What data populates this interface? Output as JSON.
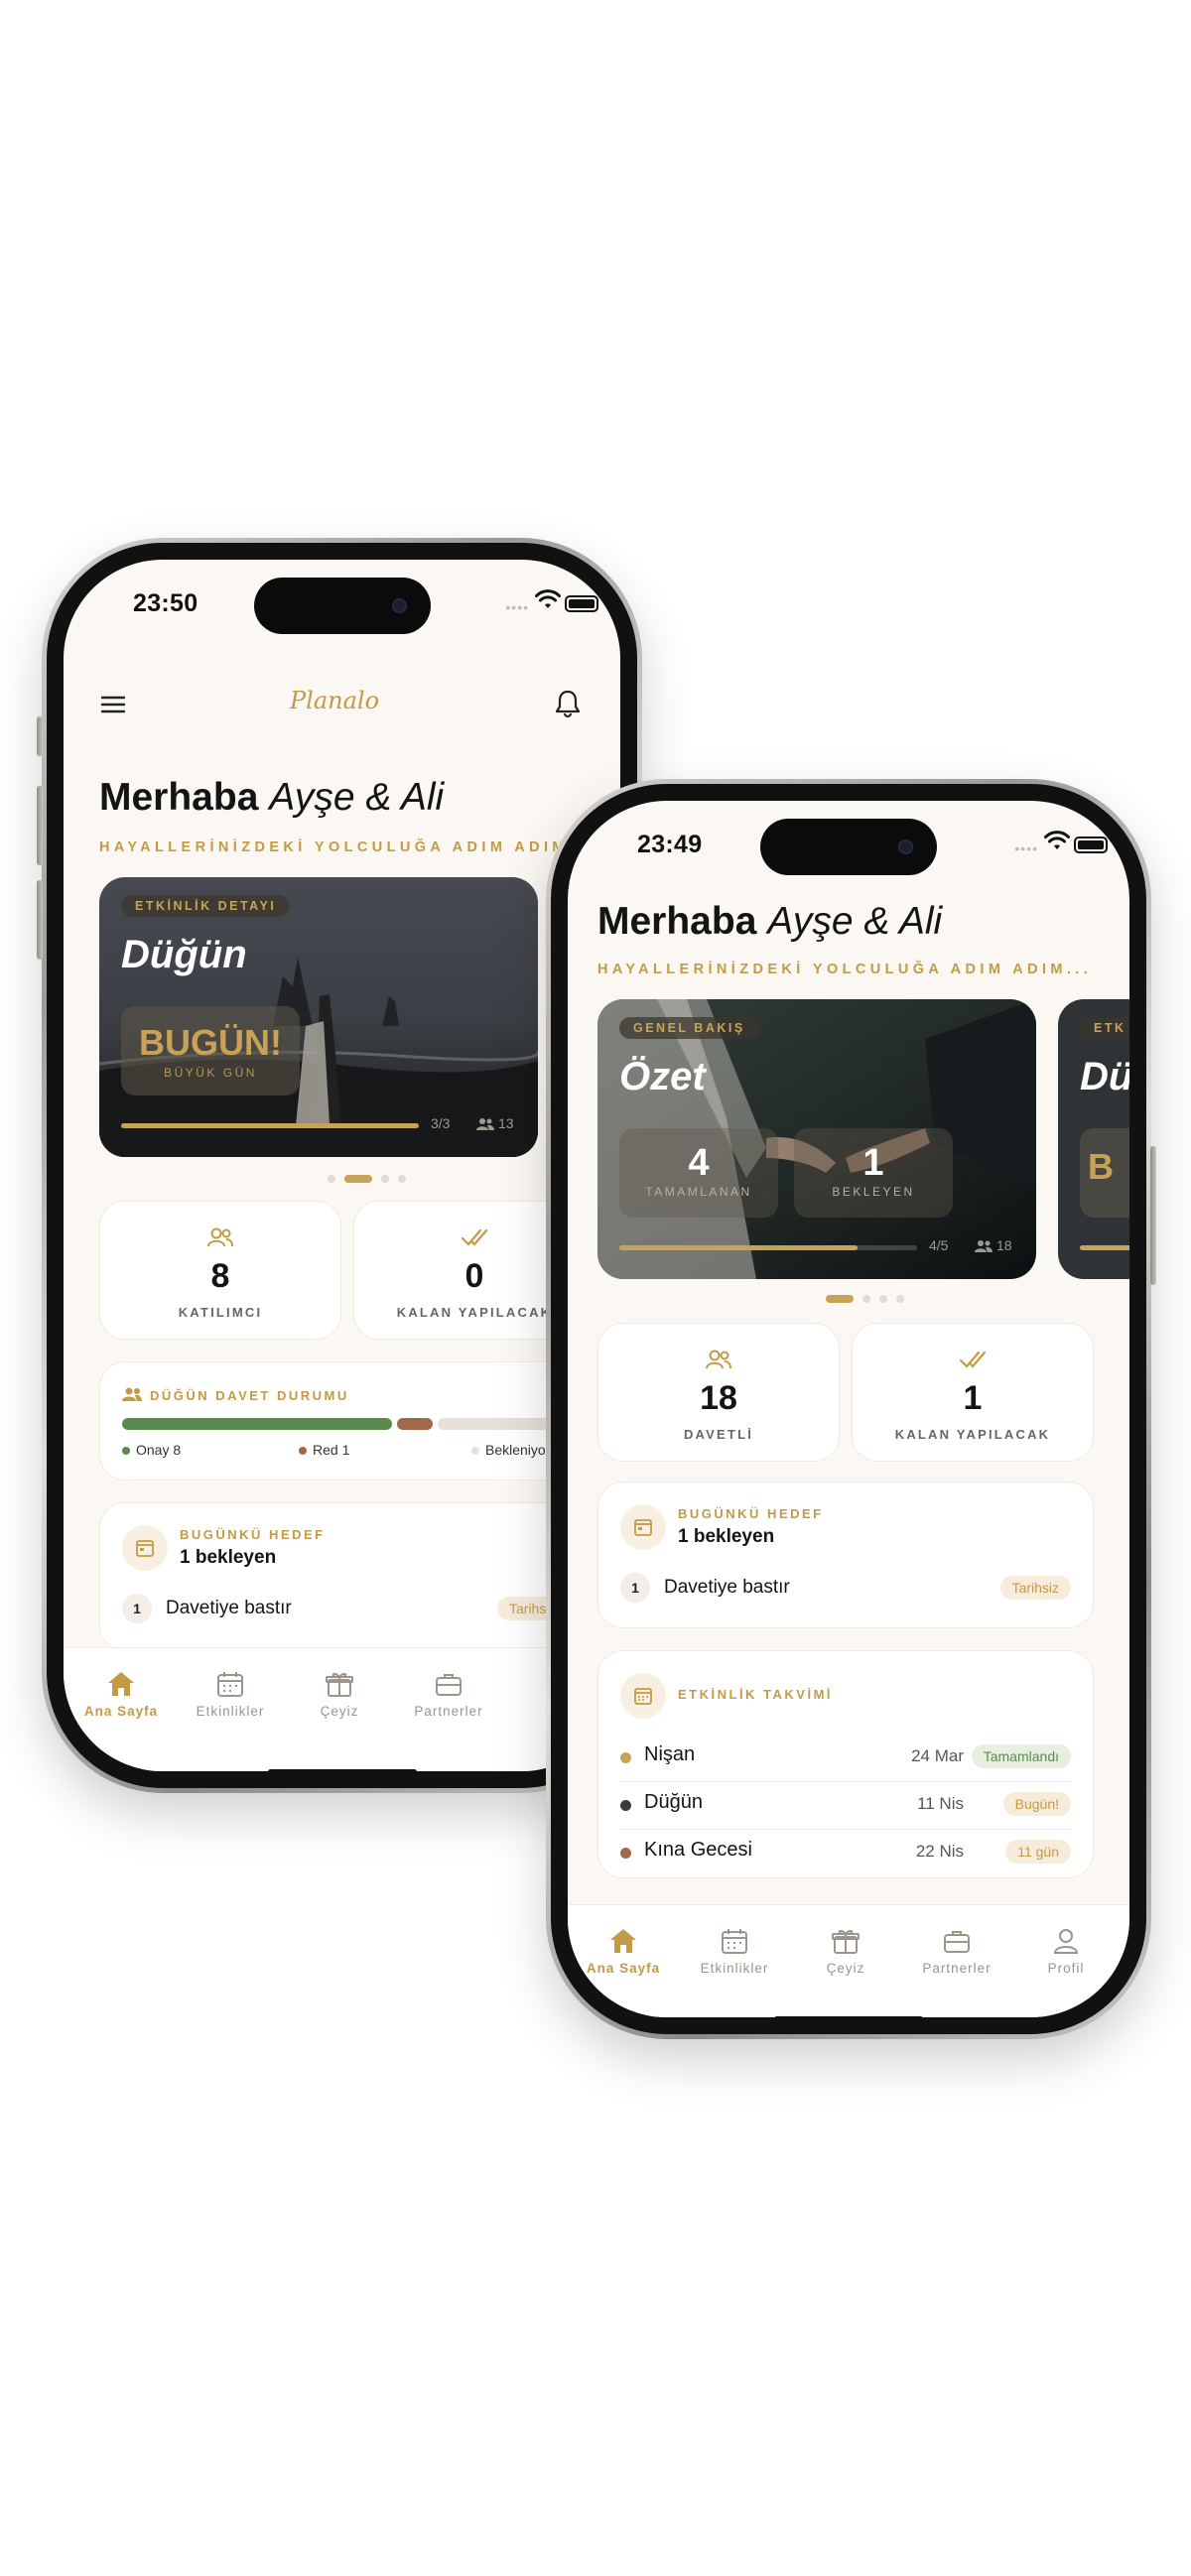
{
  "phone_left": {
    "time": "23:50",
    "logo": "Planalo",
    "greeting_bold": "Merhaba",
    "greeting_names": "Ayşe & Ali",
    "tagline": "HAYALLERİNİZDEKİ YOLCULUĞA ADIM ADIM...",
    "hero": {
      "chip": "ETKİNLİK DETAYI",
      "title": "Düğün",
      "badge_title": "BUGÜN!",
      "badge_sub": "BÜYÜK GÜN",
      "progress_text": "3/3",
      "progress_fraction": 1.0,
      "guests": "13"
    },
    "stats": [
      {
        "icon": "users-icon",
        "value": "8",
        "label": "KATILIMCI"
      },
      {
        "icon": "double-check-icon",
        "value": "0",
        "label": "KALAN YAPILACAK"
      }
    ],
    "invite": {
      "title": "DÜĞÜN DAVET DURUMU",
      "approved": "Onay 8",
      "rejected": "Red 1",
      "pending": "Bekleniyor",
      "approved_color": "#5b8a4f",
      "rejected_color": "#a0694a",
      "pending_color": "#e6e1d8"
    },
    "goal": {
      "title": "BUGÜNKÜ HEDEF",
      "subtitle": "1 bekleyen",
      "task_num": "1",
      "task": "Davetiye bastır",
      "task_tag": "Tarihsiz"
    },
    "tabs": [
      "Ana Sayfa",
      "Etkinlikler",
      "Çeyiz",
      "Partnerler"
    ]
  },
  "phone_right": {
    "time": "23:49",
    "greeting_bold": "Merhaba",
    "greeting_names": "Ayşe & Ali",
    "tagline": "HAYALLERİNİZDEKİ YOLCULUĞA ADIM ADIM...",
    "hero": {
      "chip": "GENEL BAKIŞ",
      "title": "Özet",
      "completed_value": "4",
      "completed_label": "TAMAMLANAN",
      "pending_value": "1",
      "pending_label": "BEKLEYEN",
      "progress_text": "4/5",
      "progress_fraction": 0.8,
      "guests": "18",
      "peek_chip": "ETK",
      "peek_title": "Dü",
      "peek_badge": "B"
    },
    "stats": [
      {
        "icon": "users-icon",
        "value": "18",
        "label": "DAVETLİ"
      },
      {
        "icon": "double-check-icon",
        "value": "1",
        "label": "KALAN YAPILACAK"
      }
    ],
    "goal": {
      "title": "BUGÜNKÜ HEDEF",
      "subtitle": "1 bekleyen",
      "task_num": "1",
      "task": "Davetiye bastır",
      "task_tag": "Tarihsiz"
    },
    "calendar": {
      "title": "ETKİNLİK TAKVİMİ",
      "events": [
        {
          "name": "Nişan",
          "date": "24 Mar",
          "tag": "Tamamlandı",
          "dot": "#c8a257"
        },
        {
          "name": "Düğün",
          "date": "11 Nis",
          "tag": "Bugün!",
          "dot": "#3a3a3a"
        },
        {
          "name": "Kına Gecesi",
          "date": "22 Nis",
          "tag": "11 gün",
          "dot": "#a0694a"
        }
      ]
    },
    "tabs": [
      "Ana Sayfa",
      "Etkinlikler",
      "Çeyiz",
      "Partnerler",
      "Profil"
    ]
  }
}
